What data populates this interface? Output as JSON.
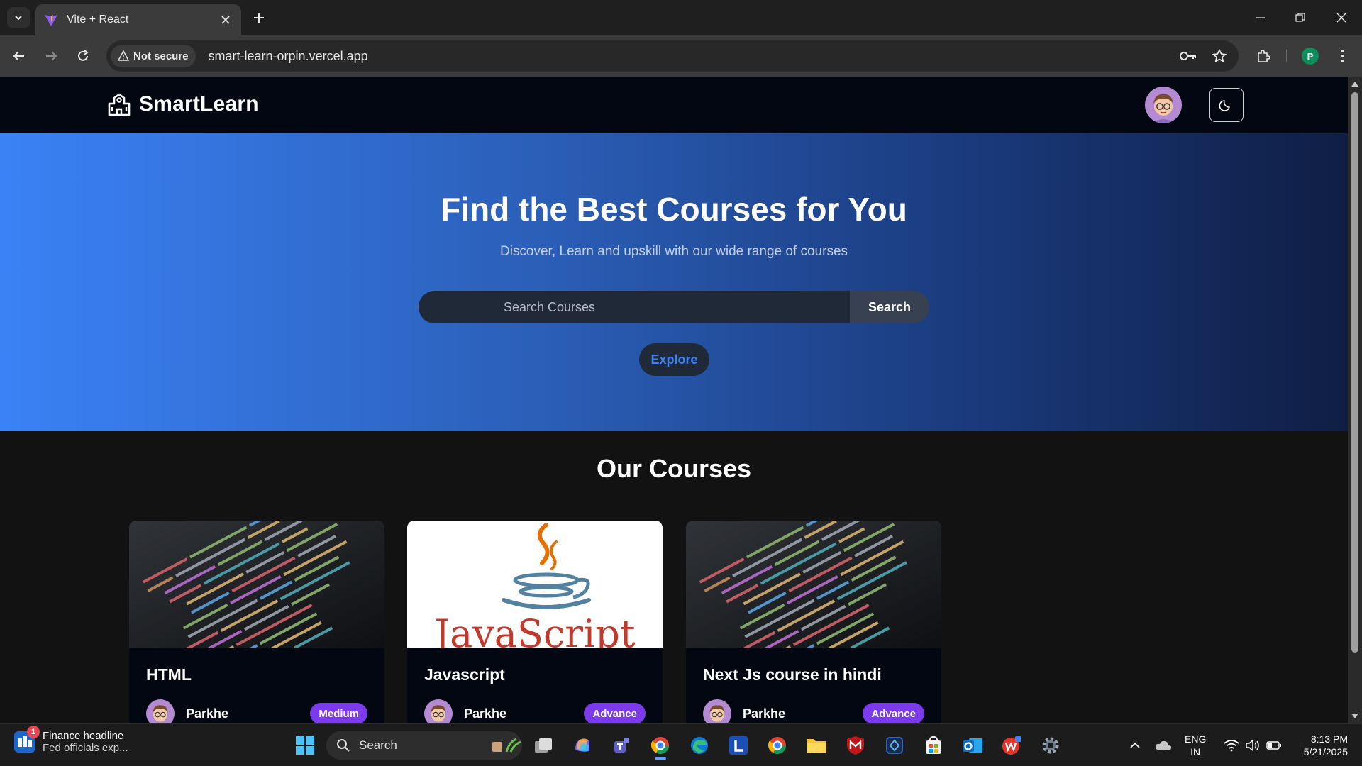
{
  "browser": {
    "tab_title": "Vite + React",
    "security_label": "Not secure",
    "url": "smart-learn-orpin.vercel.app",
    "profile_initial": "P"
  },
  "site": {
    "brand": "SmartLearn",
    "hero": {
      "title": "Find the Best Courses for You",
      "subtitle": "Discover, Learn and upskill with our wide range of courses",
      "search_placeholder": "Search Courses",
      "search_button": "Search",
      "explore_button": "Explore"
    },
    "courses_heading": "Our Courses",
    "courses": [
      {
        "title": "HTML",
        "author": "Parkhe",
        "level": "Medium",
        "thumbnail": "code-screen"
      },
      {
        "title": "Javascript",
        "author": "Parkhe",
        "level": "Advance",
        "thumbnail": "javascript-logo",
        "thumbnail_text": "JavaScript"
      },
      {
        "title": "Next Js course in hindi",
        "author": "Parkhe",
        "level": "Advance",
        "thumbnail": "code-screen"
      }
    ]
  },
  "taskbar": {
    "news_badge": "1",
    "news_title": "Finance headline",
    "news_sub": "Fed officials exp...",
    "search_label": "Search",
    "lang_top": "ENG",
    "lang_bottom": "IN",
    "time": "8:13 PM",
    "date": "5/21/2025"
  },
  "colors": {
    "hero_gradient_start": "#3b82f6",
    "hero_gradient_end": "#0f1e44",
    "badge": "#7c3aed",
    "explore_text": "#3b82f6",
    "nav_bg": "#030712"
  }
}
